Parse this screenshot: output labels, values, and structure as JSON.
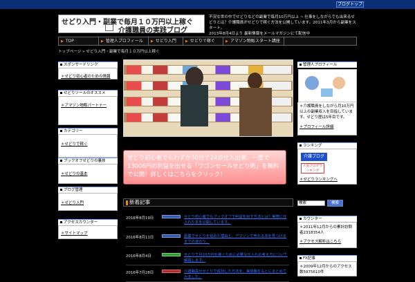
{
  "topbar": {
    "button": "ブログトップ"
  },
  "logo": {
    "line1": "せどり入門・副業で毎月１０万円以上稼ぐ",
    "line2": "介護職員の実践ブログ"
  },
  "header_text": "不況な世の中でせどりなどの副業で毎月10万円以上 ~ 仕事をしながらでも出来るせどりとは？介護職員がせどりで稼ぐ方法を公開しています。2011年3月から副業をスタート。",
  "header_meta": "2013年8月4日より 最新情報をメールマガジンにて配信中",
  "nav": {
    "items": [
      "TOP",
      "管理人プロフィール",
      "せどり入門",
      "せどりで稼ぐ",
      "アマゾン物販スタート講座"
    ]
  },
  "breadcrumb": "トップページ » せどり入門・副業で毎月１０万円以上稼ぐ",
  "left": {
    "boxes": [
      {
        "title": "スポンサードリンク",
        "link": "せどり初心者のための情報"
      },
      {
        "title": "せどりツールのオススメ",
        "link": "アマゾン物販パートナー"
      },
      {
        "title": "カテゴリー",
        "link": "せどりで稼ぐ"
      },
      {
        "title": "ブックオフせどりの裏技",
        "link": "せどりの基本"
      },
      {
        "title": "ブログ管理",
        "link": "せどり入門"
      },
      {
        "title": "アクセスカウンター",
        "link": "サイトマップ"
      }
    ]
  },
  "banner": {
    "text": "せどり初心者でもわずか30分で24点仕入出来、一度で13006円の利益を出せる「ワゴンセールせどり術」を無料で公開！詳しくはこちらをクリック！"
  },
  "main": {
    "title": "新着記事",
    "articles": [
      {
        "date": "2016年8月19日",
        "title": "せどり初心者でもブックオフで利益を出す方法とは？実際に仕入れた本を公開しています。"
      },
      {
        "date": "2016年8月11日",
        "title": "副業でせどりを始めた理由と、アマゾンで売れる本を見つけるまでの道のり。"
      },
      {
        "date": "2016年8月4日",
        "title": "せどりで月10万円を稼ぐために必要な仕入れの考え方について解説します。"
      },
      {
        "date": "2016年7月28日",
        "title": "介護職員がせどりで成功した方法を、実体験をもとにまとめてみました。"
      }
    ]
  },
  "right": {
    "profile_title": "管理人プロフィール",
    "profile_text": "介護職員をしながら月10万円以上の副業収入を目指しています。せどり歴は5年目です。",
    "profile_link": "プロフィール詳細",
    "ranking_title": "ランキング",
    "ranking_labels": [
      "介護ブログ",
      "人気ブログランキング"
    ],
    "ranking_link": "せどりランキングへ",
    "search_placeholder": "検索",
    "search_button": "検索",
    "counter_title": "カウンター",
    "counter_text": "2011年12月からの累計訪問者2318354人",
    "counter_link": "アクセス解析はこちら",
    "fx_title": "FX記事",
    "fx_text": "2009年12月からのアクセス数5975610件"
  }
}
